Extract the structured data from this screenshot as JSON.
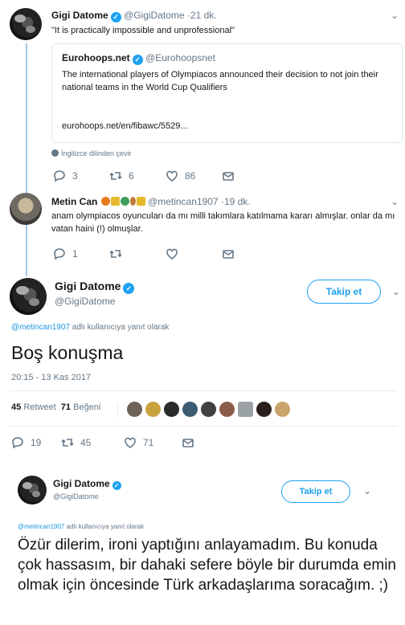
{
  "tweet1": {
    "name": "Gigi Datome",
    "handle": "@GigiDatome",
    "time": "·21 dk.",
    "text": "\"It is practically impossible and unprofessional\"",
    "quote": {
      "name": "Eurohoops.net",
      "handle": "@Eurohoopsnet",
      "text": "The international players of Olympiacos announced their decision to not join their national teams in the World Cup Qualifiers",
      "url": "eurohoops.net/en/fibawc/5529..."
    },
    "translate": "İngilizce dilinden çevir",
    "replies": "3",
    "retweets": "6",
    "likes": "86"
  },
  "tweet2": {
    "name": "Metin Can",
    "handle": "@metincan1907",
    "time": "·19 dk.",
    "text": "anam olympiacos oyuncuları da mı milli takımlara katılmama kararı almışlar. onlar da mı vatan haini (!) olmuşlar.",
    "replies": "1",
    "retweets": "",
    "likes": ""
  },
  "tweet3": {
    "name": "Gigi Datome",
    "handle": "@GigiDatome",
    "follow_label": "Takip et",
    "reply_to_handle": "@metincan1907",
    "reply_to_suffix": " adlı kullanıcıya yanıt olarak",
    "text": "Boş konuşma",
    "timestamp": "20:15 - 13 Kas 2017",
    "retweet_count": "45",
    "retweet_label": "Retweet",
    "like_count": "71",
    "like_label": "Beğeni",
    "replies": "19",
    "retweets": "45",
    "likes": "71"
  },
  "tweet4": {
    "name": "Gigi Datome",
    "handle": "@GigiDatome",
    "follow_label": "Takip et",
    "reply_to_handle": "@metincan1907",
    "reply_to_suffix": " adlı kullanıcıya yanıt olarak",
    "text": "Özür dilerim, ironi yaptığını anlayamadım. Bu konuda çok hassasım, bir dahaki sefere böyle bir durumda emin olmak için öncesinde Türk arkadaşlarıma soracağım. ;)"
  },
  "colors": {
    "accent": "#1da1f2",
    "link": "#1b95e0",
    "muted": "#657786",
    "thread": "#a5c6e6"
  },
  "icons": [
    "verified-icon",
    "chevron-down-icon",
    "reply-icon",
    "retweet-icon",
    "like-icon",
    "dm-icon",
    "globe-icon"
  ]
}
